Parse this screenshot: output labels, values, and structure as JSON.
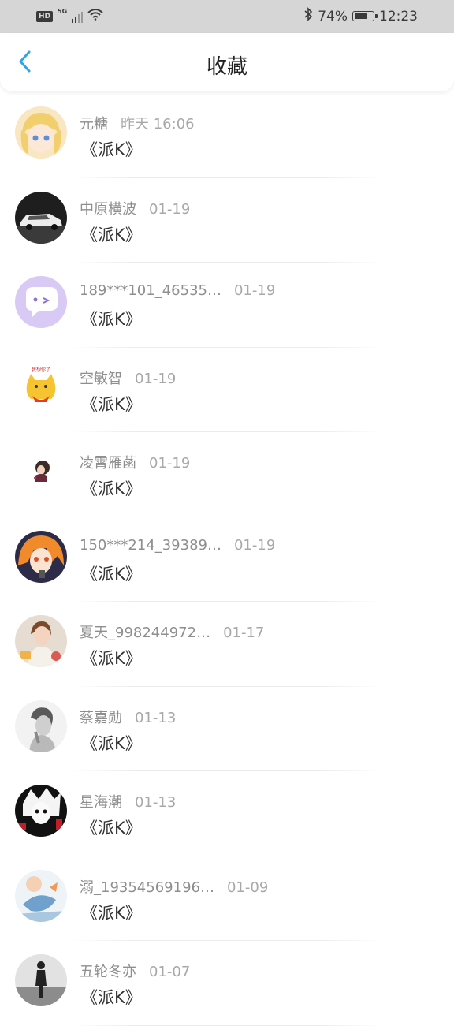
{
  "status_bar": {
    "hd": "HD",
    "network": "5G",
    "battery_percent": "74%",
    "battery_level": 0.74,
    "time": "12:23",
    "icons": [
      "signal-icon",
      "wifi-icon",
      "bluetooth-icon",
      "battery-icon"
    ]
  },
  "header": {
    "title": "收藏",
    "back_icon": "chevron-left-icon",
    "accent": "#2fa5e6"
  },
  "items": [
    {
      "name": "元糖",
      "date": "昨天 16:06",
      "content": "《派K》",
      "avatar": "anime-blonde-girl"
    },
    {
      "name": "中原横波",
      "date": "01-19",
      "content": "《派K》",
      "avatar": "white-car-dark"
    },
    {
      "name": "189***101_46535…",
      "date": "01-19",
      "content": "《派K》",
      "avatar": "purple-chat-bubble"
    },
    {
      "name": "空敏智",
      "date": "01-19",
      "content": "《派K》",
      "avatar": "cartoon-cat"
    },
    {
      "name": "凌霄雁菡",
      "date": "01-19",
      "content": "《派K》",
      "avatar": "small-girl-white"
    },
    {
      "name": "150***214_39389…",
      "date": "01-19",
      "content": "《派K》",
      "avatar": "anime-orange-hair"
    },
    {
      "name": "夏天_998244972…",
      "date": "01-17",
      "content": "《派K》",
      "avatar": "girl-photo"
    },
    {
      "name": "蔡嘉勋",
      "date": "01-13",
      "content": "《派K》",
      "avatar": "grayscale-portrait"
    },
    {
      "name": "星海潮",
      "date": "01-13",
      "content": "《派K》",
      "avatar": "manga-black-red"
    },
    {
      "name": "溺_19354569196…",
      "date": "01-09",
      "content": "《派K》",
      "avatar": "watercolor-fish"
    },
    {
      "name": "五轮冬亦",
      "date": "01-07",
      "content": "《派K》",
      "avatar": "silhouette-figure"
    }
  ]
}
